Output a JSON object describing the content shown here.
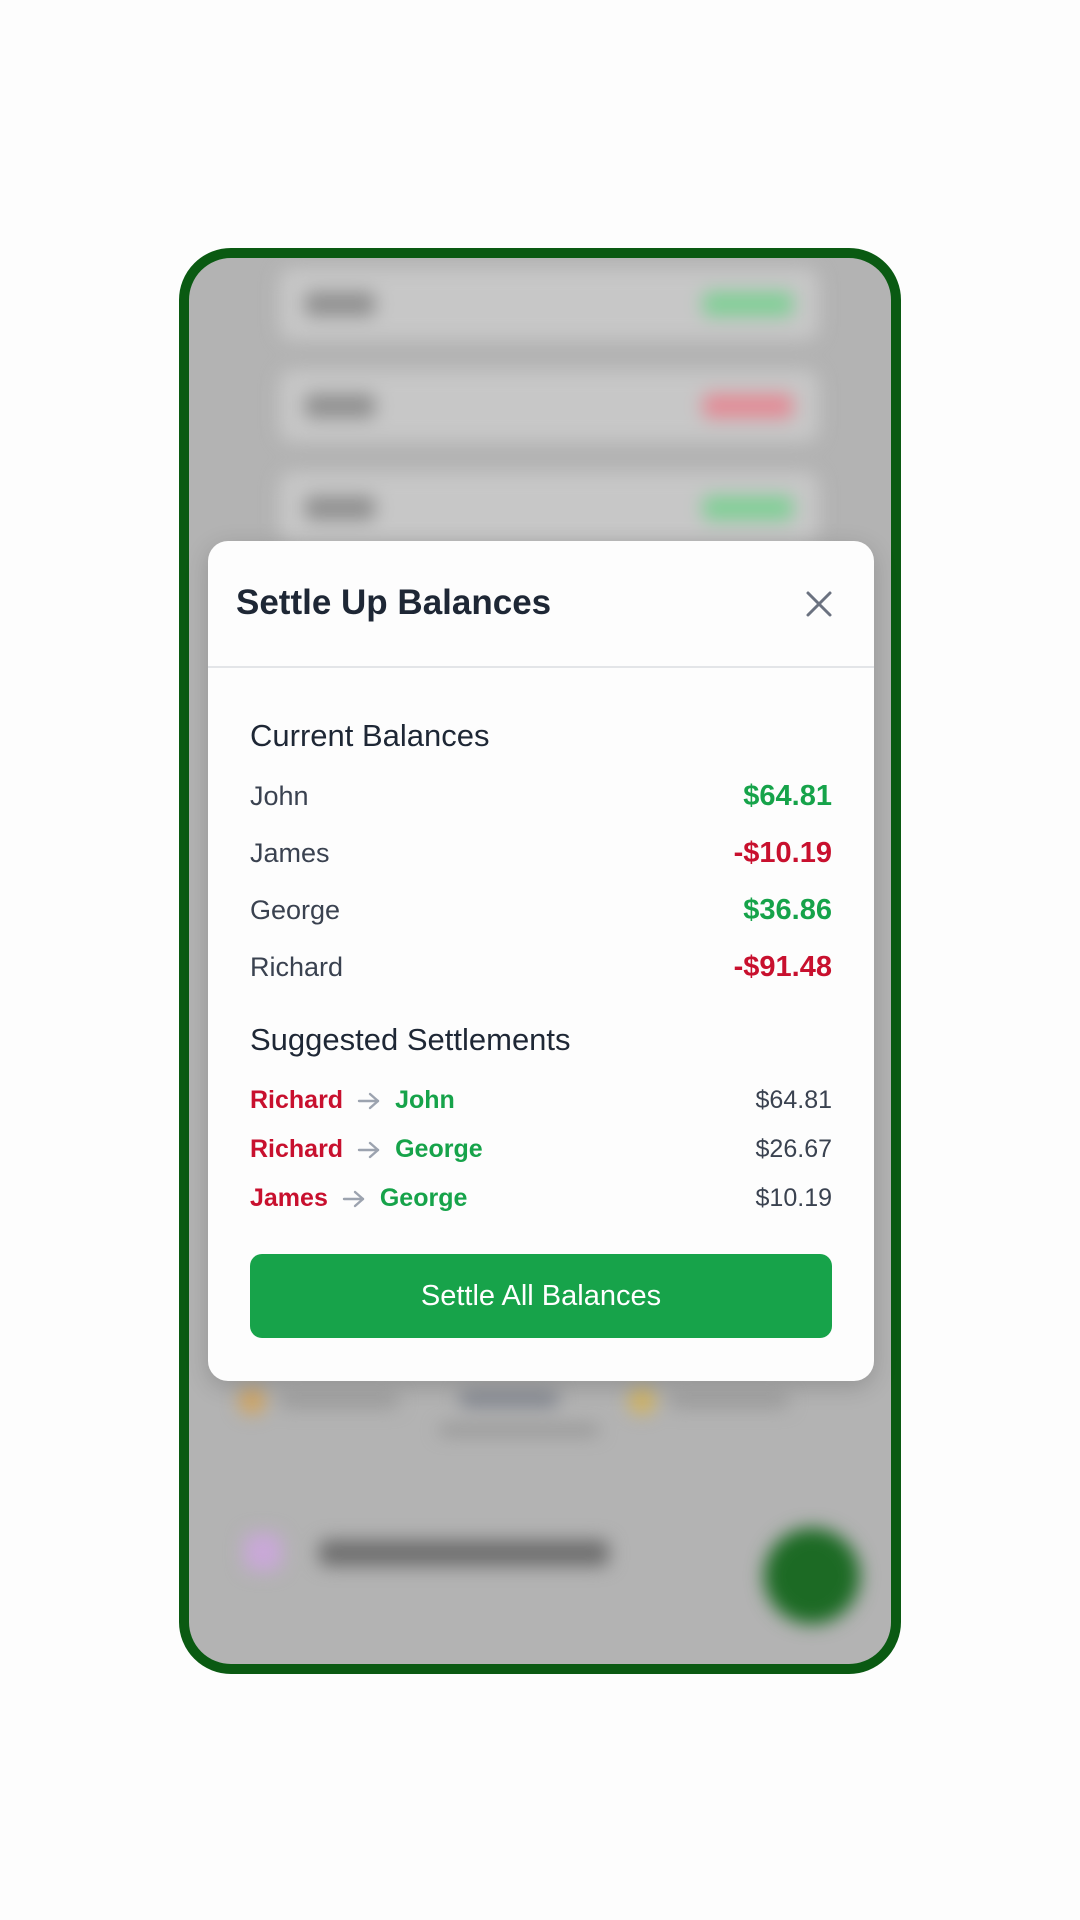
{
  "modal": {
    "title": "Settle Up Balances",
    "close_icon": "close-icon"
  },
  "current_balances": {
    "heading": "Current Balances",
    "rows": [
      {
        "name": "John",
        "amount": "$64.81",
        "status": "positive"
      },
      {
        "name": "James",
        "amount": "-$10.19",
        "status": "negative"
      },
      {
        "name": "George",
        "amount": "$36.86",
        "status": "positive"
      },
      {
        "name": "Richard",
        "amount": "-$91.48",
        "status": "negative"
      }
    ]
  },
  "suggested_settlements": {
    "heading": "Suggested Settlements",
    "arrow_icon": "arrow-right-icon",
    "rows": [
      {
        "from": "Richard",
        "to": "John",
        "amount": "$64.81"
      },
      {
        "from": "Richard",
        "to": "George",
        "amount": "$26.67"
      },
      {
        "from": "James",
        "to": "George",
        "amount": "$10.19"
      }
    ]
  },
  "action": {
    "settle_all_label": "Settle All Balances"
  },
  "colors": {
    "positive": "#16a34a",
    "negative": "#c8102e",
    "primary_button": "#17a34a",
    "device_frame": "#0a5a12",
    "title_text": "#1e2735"
  }
}
